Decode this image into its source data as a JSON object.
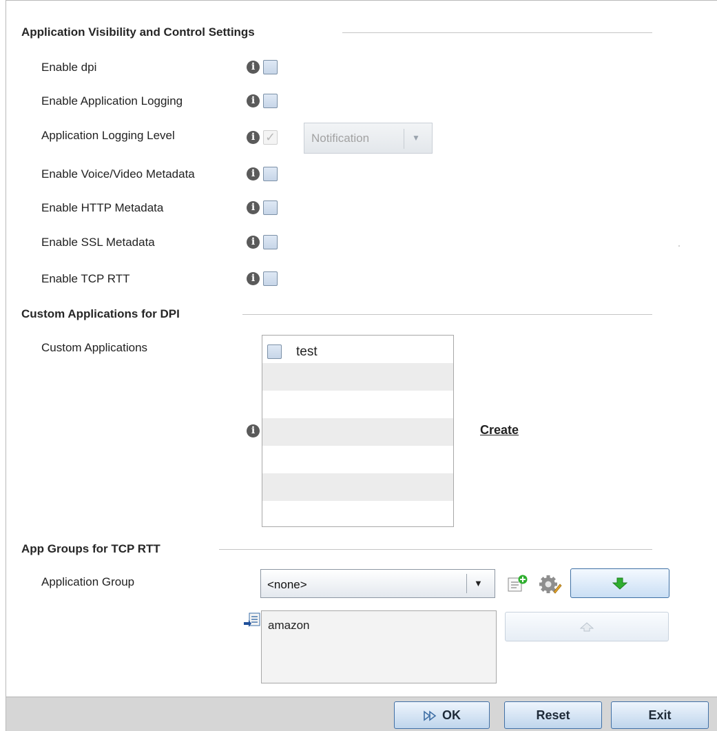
{
  "sections": {
    "visibility": {
      "title": "Application Visibility and Control Settings"
    },
    "custom_apps": {
      "title": "Custom Applications for DPI"
    },
    "app_groups": {
      "title": "App Groups for TCP RTT"
    }
  },
  "settings": [
    {
      "label": "Enable dpi",
      "checked": false
    },
    {
      "label": "Enable Application Logging",
      "checked": false
    },
    {
      "label": "Application Logging Level",
      "checked": true,
      "disabled": true
    },
    {
      "label": "Enable Voice/Video Metadata",
      "checked": false
    },
    {
      "label": "Enable HTTP Metadata",
      "checked": false
    },
    {
      "label": "Enable SSL Metadata",
      "checked": false
    },
    {
      "label": "Enable TCP RTT",
      "checked": false
    }
  ],
  "logging_level": {
    "value": "Notification",
    "disabled": true
  },
  "custom_applications": {
    "label": "Custom Applications",
    "items": [
      {
        "label": "test",
        "checked": false
      }
    ],
    "create_link": "Create"
  },
  "application_group": {
    "label": "Application Group",
    "selected": "<none>",
    "members": [
      "amazon"
    ]
  },
  "icons": {
    "info": "info-icon",
    "add": "add-item-icon",
    "settings": "gear-icon",
    "move_down": "green-down-arrow-icon",
    "move_up": "up-arrow-icon",
    "list_insert": "list-insert-icon",
    "ok": "double-arrow-icon"
  },
  "footer": {
    "ok": "OK",
    "reset": "Reset",
    "exit": "Exit"
  },
  "colors": {
    "accent_green": "#2fae2f",
    "button_border": "#3f6fa5",
    "footer_bg": "#d6d6d6"
  }
}
